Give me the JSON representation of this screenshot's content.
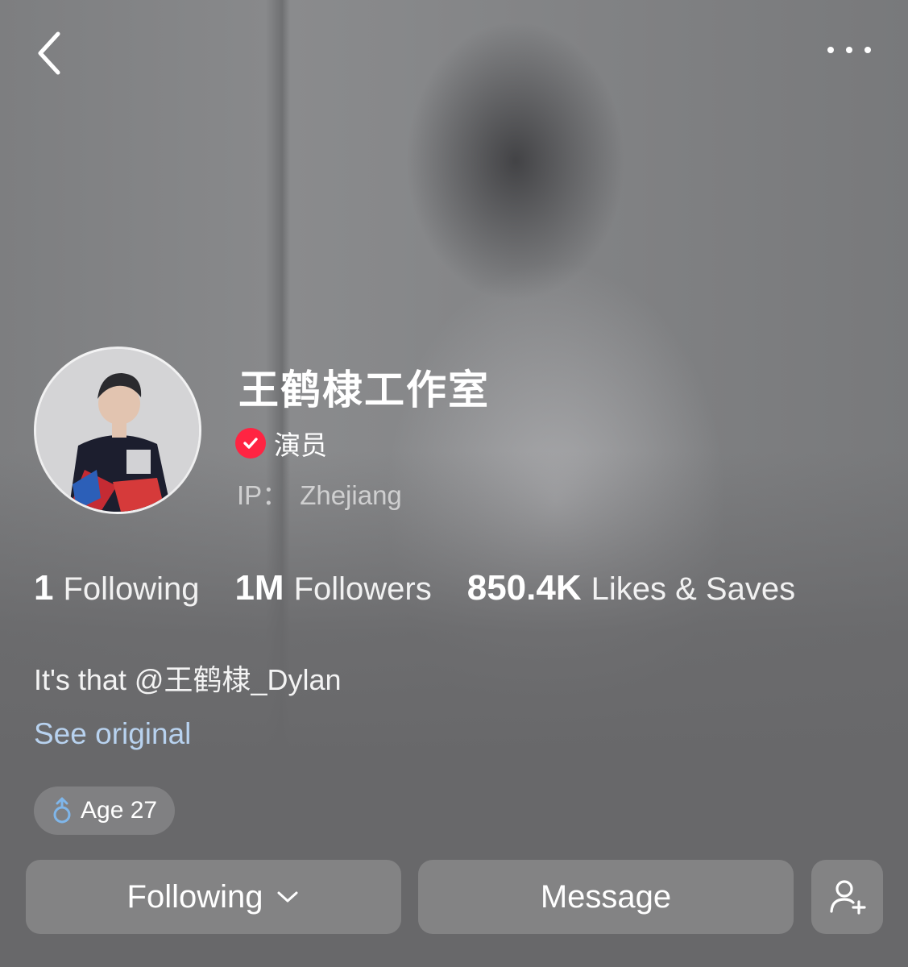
{
  "profile": {
    "name": "王鹤棣工作室",
    "verification_label": "演员",
    "ip_label": "IP：",
    "ip_location": "Zhejiang",
    "bio": "It's that @王鹤棣_Dylan",
    "see_original": "See original",
    "age_tag": "Age 27",
    "gender_icon": "male-icon"
  },
  "stats": [
    {
      "value": "1",
      "label": "Following"
    },
    {
      "value": "1M",
      "label": "Followers"
    },
    {
      "value": "850.4K",
      "label": "Likes & Saves"
    }
  ],
  "actions": {
    "following_label": "Following",
    "message_label": "Message",
    "add_friend_icon": "add-user-icon"
  },
  "colors": {
    "verify_badge": "#ff2442",
    "link": "#b8d2ef",
    "gender_icon": "#7fb6ea"
  }
}
